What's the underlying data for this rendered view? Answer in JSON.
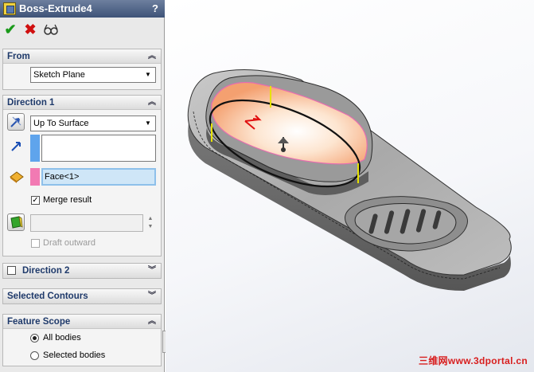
{
  "window": {
    "title": "Boss-Extrude4",
    "help": "?"
  },
  "actions": {
    "ok": "✔",
    "cancel": "✖",
    "preview": "δσ"
  },
  "from": {
    "header": "From",
    "value": "Sketch Plane"
  },
  "direction1": {
    "header": "Direction 1",
    "end_condition": "Up To Surface",
    "face_value": "Face<1>",
    "merge_label": "Merge result",
    "merge_checked": true,
    "draft_label": "Draft outward",
    "draft_checked": false
  },
  "direction2": {
    "header": "Direction 2",
    "checked": false
  },
  "selected_contours": {
    "header": "Selected Contours"
  },
  "feature_scope": {
    "header": "Feature Scope",
    "options": [
      "All bodies",
      "Selected bodies"
    ],
    "selected": "All bodies"
  },
  "watermark": "三维网www.3dportal.cn",
  "icons": {
    "dialog": "boss-extrude-feature-icon",
    "collapse": "double-chevron-up-icon",
    "expand": "double-chevron-down-icon",
    "reverse": "reverse-direction-icon",
    "direction_arrow": "direction-arrow-icon",
    "face_selector": "face-selection-icon",
    "draft": "draft-icon"
  },
  "colors": {
    "title_bar": "#4a5f86",
    "group_header_text": "#1f3a6b",
    "selection_blue": "#5fa4ec",
    "selection_pink": "#f27ab3"
  }
}
